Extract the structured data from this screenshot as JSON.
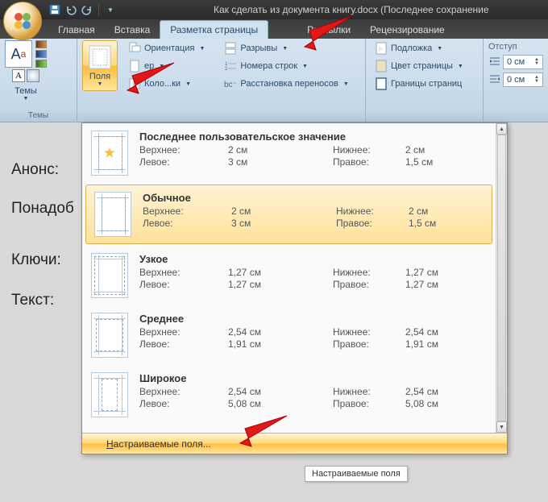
{
  "title": "Как сделать из документа книгу.docx (Последнее сохранение ",
  "tabs": {
    "home": "Главная",
    "insert": "Вставка",
    "layout": "Разметка страницы",
    "mail": "Рассылки",
    "review": "Рецензирование"
  },
  "ribbon": {
    "themes_group": "Темы",
    "themes_btn": "Темы",
    "margins_btn": "Поля",
    "orientation": "Ориентация",
    "size_hidden": "ер",
    "columns_hidden": "Коло...ки",
    "breaks": "Разрывы",
    "line_numbers": "Номера строк",
    "hyphenation": "Расстановка переносов",
    "watermark": "Подложка",
    "page_color": "Цвет страницы",
    "page_borders": "Границы страниц",
    "indent_group": "Отступ",
    "indent_left": "0 см",
    "indent_right": "0 см"
  },
  "doc": {
    "t1": "Анонс:",
    "t2": "Понадоб",
    "t3": "Ключи:",
    "t4": "Текст:"
  },
  "margins": {
    "labels": {
      "top": "Верхнее:",
      "bottom": "Нижнее:",
      "left": "Левое:",
      "right": "Правое:"
    },
    "items": [
      {
        "name": "Последнее пользовательское значение",
        "top": "2 см",
        "bottom": "2 см",
        "left": "3 см",
        "right": "1,5 см",
        "sel": false,
        "star": true
      },
      {
        "name": "Обычное",
        "top": "2 см",
        "bottom": "2 см",
        "left": "3 см",
        "right": "1,5 см",
        "sel": true,
        "star": false
      },
      {
        "name": "Узкое",
        "top": "1,27 см",
        "bottom": "1,27 см",
        "left": "1,27 см",
        "right": "1,27 см",
        "sel": false,
        "star": false
      },
      {
        "name": "Среднее",
        "top": "2,54 см",
        "bottom": "2,54 см",
        "left": "1,91 см",
        "right": "1,91 см",
        "sel": false,
        "star": false
      },
      {
        "name": "Широкое",
        "top": "2,54 см",
        "bottom": "2,54 см",
        "left": "5,08 см",
        "right": "5,08 см",
        "sel": false,
        "star": false
      }
    ],
    "custom": "Настраиваемые поля...",
    "custom_u": "Н",
    "custom_rest": "астраиваемые поля..."
  },
  "tooltip": "Настраиваемые поля"
}
